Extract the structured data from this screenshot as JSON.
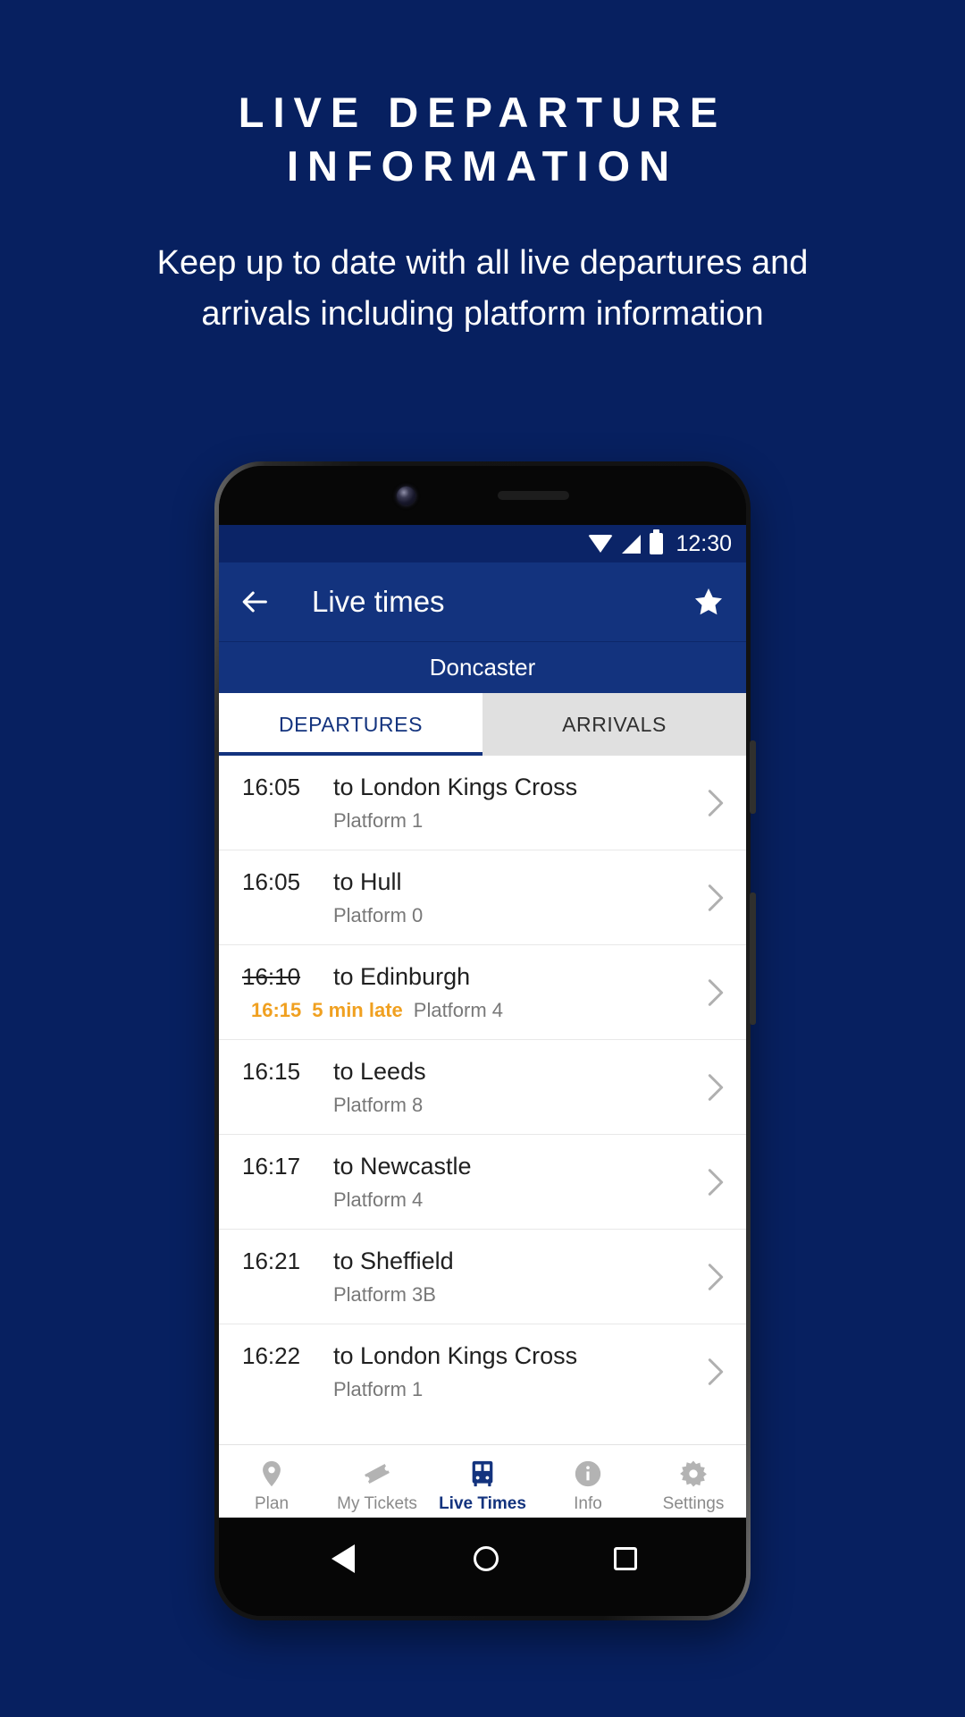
{
  "promo": {
    "title": "LIVE DEPARTURE INFORMATION",
    "subtitle": "Keep up to date with all live departures and arrivals including platform information"
  },
  "colors": {
    "background": "#072060",
    "appbar": "#13337e",
    "statusbar": "#0b2467",
    "accent": "#13337e",
    "late": "#f0a020",
    "muted": "#787878"
  },
  "phone": {
    "statusbar": {
      "time": "12:30",
      "icons": [
        "wifi-icon",
        "signal-icon",
        "battery-icon"
      ]
    },
    "appbar": {
      "back_icon": "back-arrow-icon",
      "title": "Live times",
      "favourite_icon": "star-icon"
    },
    "station": "Doncaster",
    "tabs": [
      {
        "label": "DEPARTURES",
        "active": true
      },
      {
        "label": "ARRIVALS",
        "active": false
      }
    ],
    "departures": [
      {
        "time": "16:05",
        "destination": "to London Kings Cross",
        "platform": "Platform 1",
        "delayed": false,
        "new_time": "",
        "delay_text": ""
      },
      {
        "time": "16:05",
        "destination": "to Hull",
        "platform": "Platform 0",
        "delayed": false,
        "new_time": "",
        "delay_text": ""
      },
      {
        "time": "16:10",
        "destination": "to Edinburgh",
        "platform": "Platform 4",
        "delayed": true,
        "new_time": "16:15",
        "delay_text": "5 min late"
      },
      {
        "time": "16:15",
        "destination": "to Leeds",
        "platform": "Platform 8",
        "delayed": false,
        "new_time": "",
        "delay_text": ""
      },
      {
        "time": "16:17",
        "destination": "to Newcastle",
        "platform": "Platform 4",
        "delayed": false,
        "new_time": "",
        "delay_text": ""
      },
      {
        "time": "16:21",
        "destination": "to Sheffield",
        "platform": "Platform 3B",
        "delayed": false,
        "new_time": "",
        "delay_text": ""
      },
      {
        "time": "16:22",
        "destination": "to London Kings Cross",
        "platform": "Platform 1",
        "delayed": false,
        "new_time": "",
        "delay_text": ""
      }
    ],
    "bottom_nav": [
      {
        "label": "Plan",
        "icon": "map-pin-icon",
        "active": false
      },
      {
        "label": "My Tickets",
        "icon": "ticket-icon",
        "active": false
      },
      {
        "label": "Live Times",
        "icon": "train-icon",
        "active": true
      },
      {
        "label": "Info",
        "icon": "info-circle-icon",
        "active": false
      },
      {
        "label": "Settings",
        "icon": "gear-icon",
        "active": false
      }
    ],
    "android_nav": [
      "back-triangle-icon",
      "home-circle-icon",
      "recents-square-icon"
    ]
  }
}
